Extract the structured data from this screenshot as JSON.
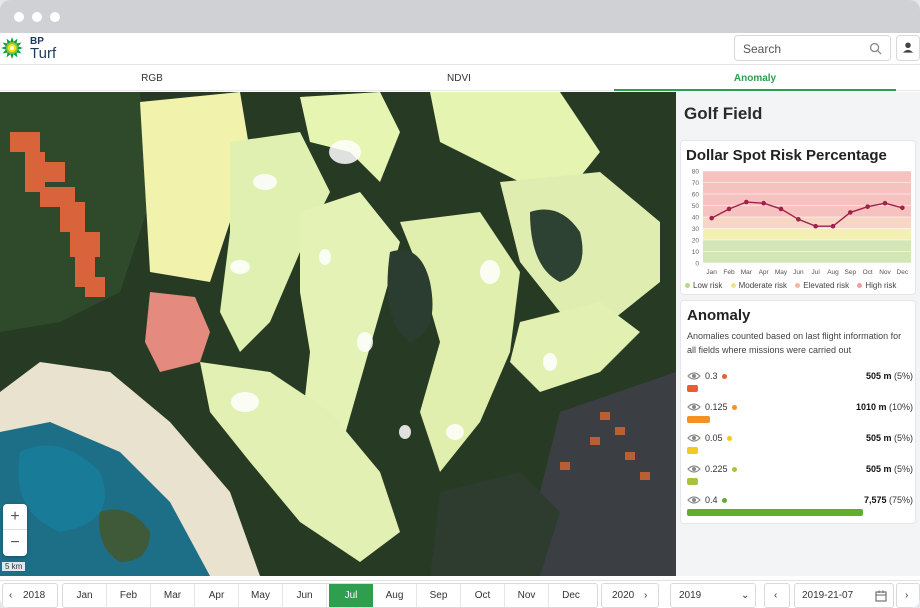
{
  "app": {
    "brand_small": "BP",
    "brand_name": "Turf"
  },
  "search": {
    "placeholder": "Search"
  },
  "tabs": [
    {
      "label": "RGB",
      "active": false
    },
    {
      "label": "NDVI",
      "active": false
    },
    {
      "label": "Anomaly",
      "active": true
    }
  ],
  "map": {
    "scale_label": "5 km",
    "zoom_in": "+",
    "zoom_out": "−"
  },
  "panel": {
    "title": "Golf Field",
    "chart_title": "Dollar Spot Risk Percentage",
    "legend": [
      {
        "label": "Low risk",
        "color": "#b6d88a"
      },
      {
        "label": "Moderate risk",
        "color": "#f0e48a"
      },
      {
        "label": "Elevated risk",
        "color": "#f4b6a6"
      },
      {
        "label": "High risk",
        "color": "#ee9fa0"
      }
    ]
  },
  "chart_data": {
    "type": "line",
    "title": "Dollar Spot Risk Percentage",
    "categories": [
      "Jan",
      "Feb",
      "Mar",
      "Apr",
      "May",
      "Jun",
      "Jul",
      "Aug",
      "Sep",
      "Oct",
      "Nov",
      "Dec"
    ],
    "series": [
      {
        "values": [
          39,
          47,
          53,
          52,
          47,
          38,
          32,
          32,
          44,
          49,
          52,
          48
        ],
        "color": "#a0224a"
      }
    ],
    "yticks": [
      80,
      70,
      60,
      50,
      40,
      30,
      20,
      10,
      0
    ],
    "ylim": [
      0,
      80
    ],
    "bands": [
      {
        "from": 0,
        "to": 20,
        "color": "#d3e6b6"
      },
      {
        "from": 20,
        "to": 30,
        "color": "#f4efb2"
      },
      {
        "from": 30,
        "to": 40,
        "color": "#f7d6c3"
      },
      {
        "from": 40,
        "to": 80,
        "color": "#f5c2c0"
      }
    ],
    "grid": true
  },
  "anomaly": {
    "title": "Anomaly",
    "subtitle": "Anomalies counted based on last flight information for all fields where missions were carried out",
    "rows": [
      {
        "value": "0.3",
        "color": "#ef5b30",
        "distance": "505 m",
        "percent": "(5%)",
        "fraction": 0.05
      },
      {
        "value": "0.125",
        "color": "#f39222",
        "distance": "1010 m",
        "percent": "(10%)",
        "fraction": 0.1
      },
      {
        "value": "0.05",
        "color": "#f2c91c",
        "distance": "505 m",
        "percent": "(5%)",
        "fraction": 0.05
      },
      {
        "value": "0.225",
        "color": "#a8c43c",
        "distance": "505 m",
        "percent": "(5%)",
        "fraction": 0.05
      },
      {
        "value": "0.4",
        "color": "#5eaf2e",
        "distance": "7,575",
        "percent": "(75%)",
        "fraction": 0.78
      }
    ]
  },
  "timeline": {
    "prev_year": "2018",
    "months": [
      "Jan",
      "Feb",
      "Mar",
      "Apr",
      "May",
      "Jun",
      "Jul",
      "Aug",
      "Sep",
      "Oct",
      "Nov",
      "Dec"
    ],
    "active_month": "Jul",
    "next_year": "2020",
    "year_select": "2019",
    "date": "2019-21-07"
  },
  "colors": {
    "accent": "#2e9e4f",
    "titlebar": "#cfd1d4"
  }
}
